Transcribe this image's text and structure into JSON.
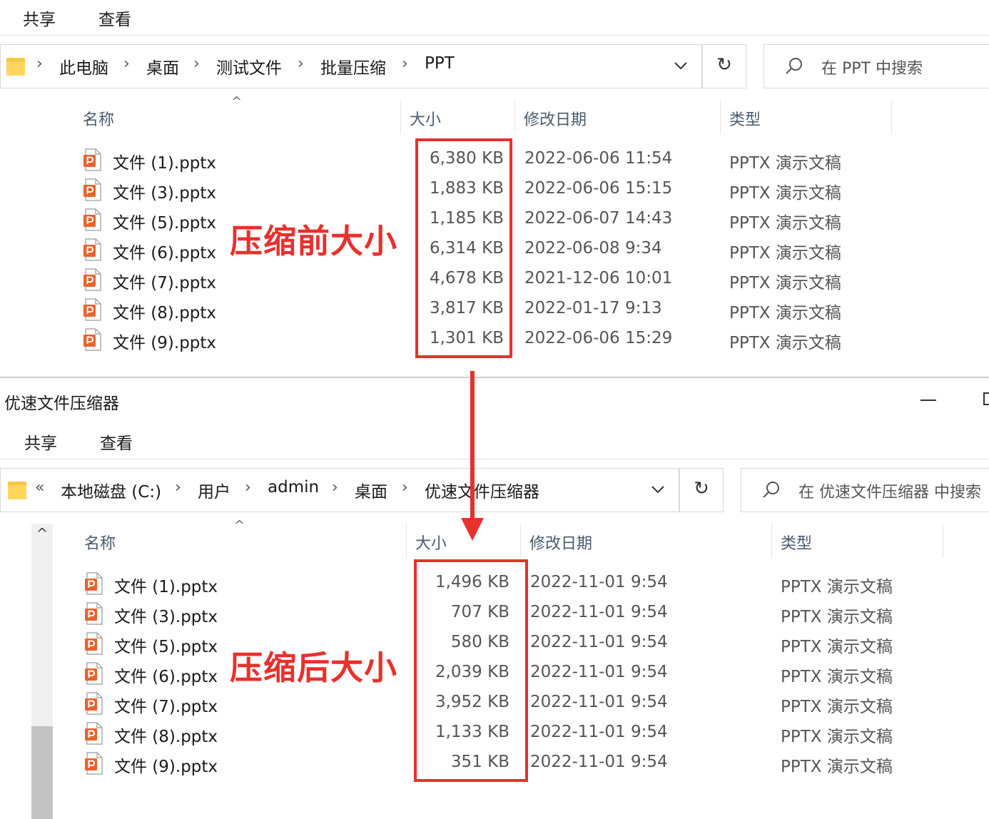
{
  "top_window": {
    "ribbon": {
      "share": "共享",
      "view": "查看"
    },
    "address": {
      "crumbs": [
        "此电脑",
        "桌面",
        "测试文件",
        "批量压缩",
        "PPT"
      ]
    },
    "search_placeholder": "在 PPT 中搜索",
    "headers": {
      "name": "名称",
      "size": "大小",
      "modified": "修改日期",
      "type": "类型"
    },
    "files": [
      {
        "name": "文件 (1).pptx",
        "size": "6,380 KB",
        "modified": "2022-06-06 11:54",
        "type": "PPTX 演示文稿"
      },
      {
        "name": "文件 (3).pptx",
        "size": "1,883 KB",
        "modified": "2022-06-06 15:15",
        "type": "PPTX 演示文稿"
      },
      {
        "name": "文件 (5).pptx",
        "size": "1,185 KB",
        "modified": "2022-06-07 14:43",
        "type": "PPTX 演示文稿"
      },
      {
        "name": "文件 (6).pptx",
        "size": "6,314 KB",
        "modified": "2022-06-08 9:34",
        "type": "PPTX 演示文稿"
      },
      {
        "name": "文件 (7).pptx",
        "size": "4,678 KB",
        "modified": "2021-12-06 10:01",
        "type": "PPTX 演示文稿"
      },
      {
        "name": "文件 (8).pptx",
        "size": "3,817 KB",
        "modified": "2022-01-17 9:13",
        "type": "PPTX 演示文稿"
      },
      {
        "name": "文件 (9).pptx",
        "size": "1,301 KB",
        "modified": "2022-06-06 15:29",
        "type": "PPTX 演示文稿"
      }
    ],
    "annotation": "压缩前大小"
  },
  "bottom_window": {
    "title": "优速文件压缩器",
    "ribbon": {
      "share": "共享",
      "view": "查看"
    },
    "address": {
      "overflow": "«",
      "crumbs": [
        "本地磁盘 (C:)",
        "用户",
        "admin",
        "桌面",
        "优速文件压缩器"
      ]
    },
    "search_placeholder": "在 优速文件压缩器 中搜索",
    "headers": {
      "name": "名称",
      "size": "大小",
      "modified": "修改日期",
      "type": "类型"
    },
    "files": [
      {
        "name": "文件 (1).pptx",
        "size": "1,496 KB",
        "modified": "2022-11-01 9:54",
        "type": "PPTX 演示文稿"
      },
      {
        "name": "文件 (3).pptx",
        "size": "707 KB",
        "modified": "2022-11-01 9:54",
        "type": "PPTX 演示文稿"
      },
      {
        "name": "文件 (5).pptx",
        "size": "580 KB",
        "modified": "2022-11-01 9:54",
        "type": "PPTX 演示文稿"
      },
      {
        "name": "文件 (6).pptx",
        "size": "2,039 KB",
        "modified": "2022-11-01 9:54",
        "type": "PPTX 演示文稿"
      },
      {
        "name": "文件 (7).pptx",
        "size": "3,952 KB",
        "modified": "2022-11-01 9:54",
        "type": "PPTX 演示文稿"
      },
      {
        "name": "文件 (8).pptx",
        "size": "1,133 KB",
        "modified": "2022-11-01 9:54",
        "type": "PPTX 演示文稿"
      },
      {
        "name": "文件 (9).pptx",
        "size": "351 KB",
        "modified": "2022-11-01 9:54",
        "type": "PPTX 演示文稿"
      }
    ],
    "annotation": "压缩后大小"
  },
  "colors": {
    "annotation_red": "#e8302d",
    "folder_yellow": "#ffd65c",
    "pptx_orange": "#e8632b"
  },
  "icons": {
    "folder": "folder-icon",
    "pptx": "pptx-file-icon",
    "search": "search-icon",
    "refresh": "refresh-icon",
    "chevron": "chevron-down-icon"
  }
}
